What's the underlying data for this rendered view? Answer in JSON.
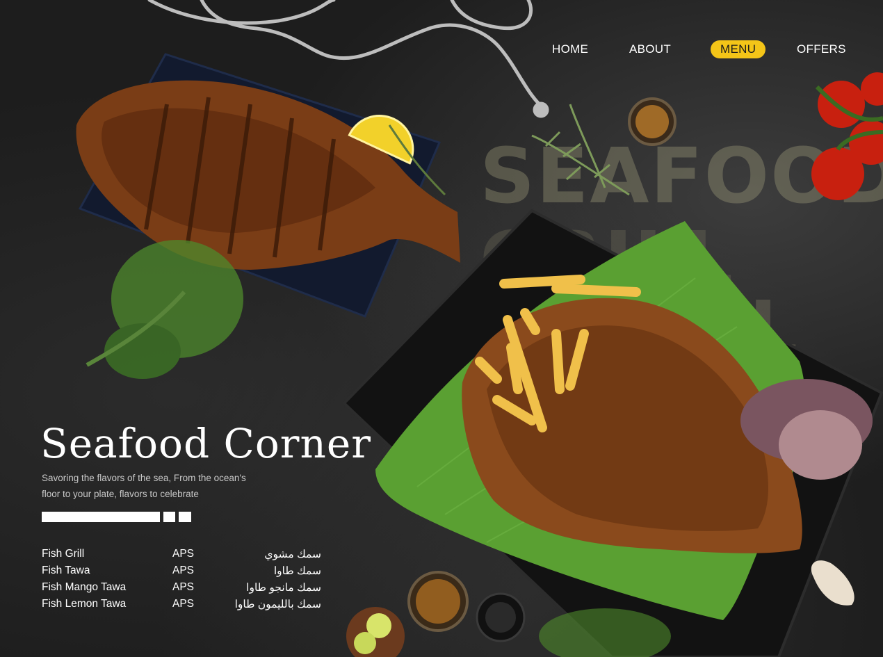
{
  "nav": {
    "items": [
      {
        "label": "HOME",
        "active": false
      },
      {
        "label": "ABOUT",
        "active": false
      },
      {
        "label": "MENU",
        "active": true
      },
      {
        "label": "OFFERS",
        "active": false
      }
    ],
    "active_color": "#f4c518"
  },
  "hero": {
    "title": "Seafood Corner",
    "subtitle_line1": "Savoring the flavors of the sea, From the ocean's",
    "subtitle_line2": "floor to your plate, flavors to celebrate",
    "watermark_line1": "SEAFOOD",
    "watermark_line2": "GRILL",
    "watermark_line3": "AL"
  },
  "menu": {
    "items": [
      {
        "name": "Fish Grill",
        "price": "APS",
        "arabic": "سمك مشوي"
      },
      {
        "name": "Fish Tawa",
        "price": "APS",
        "arabic": "سمك طاوا"
      },
      {
        "name": "Fish Mango Tawa",
        "price": "APS",
        "arabic": "سمك مانجو طاوا"
      },
      {
        "name": "Fish Lemon Tawa",
        "price": "APS",
        "arabic": "سمك بالليمون طاوا"
      }
    ]
  },
  "colors": {
    "background": "#1d1d1d",
    "accent": "#f4c518",
    "leaf": "#5aa032",
    "fish": "#8a4a1c"
  },
  "imagery": [
    "grilled-fish-plate",
    "fish-on-banana-leaf",
    "rope",
    "tomatoes",
    "lemon",
    "rosemary",
    "garlic",
    "fries",
    "salad",
    "sauce-bowls"
  ]
}
